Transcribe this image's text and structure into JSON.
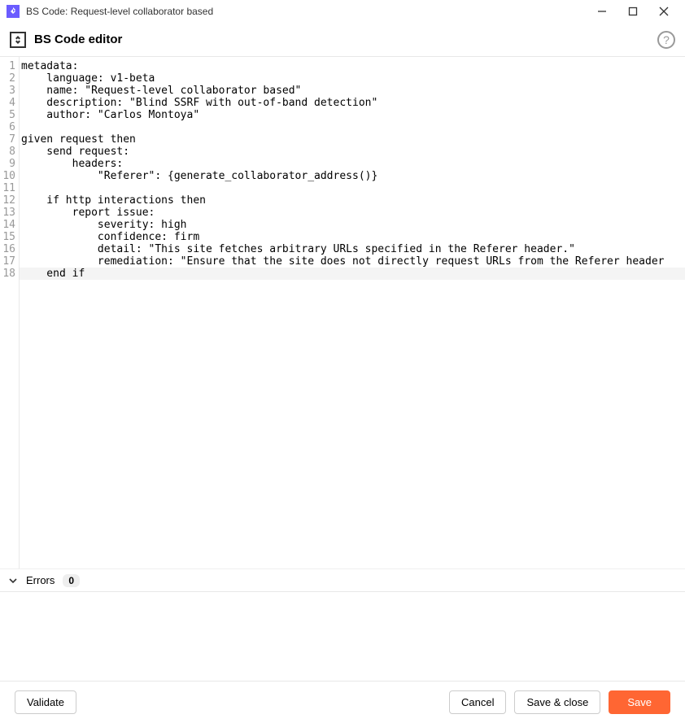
{
  "window": {
    "title": "BS Code: Request-level collaborator based"
  },
  "header": {
    "title": "BS Code editor"
  },
  "editor": {
    "lines": [
      "metadata:",
      "    language: v1-beta",
      "    name: \"Request-level collaborator based\"",
      "    description: \"Blind SSRF with out-of-band detection\"",
      "    author: \"Carlos Montoya\"",
      "",
      "given request then",
      "    send request:",
      "        headers:",
      "            \"Referer\": {generate_collaborator_address()}",
      "",
      "    if http interactions then",
      "        report issue:",
      "            severity: high",
      "            confidence: firm",
      "            detail: \"This site fetches arbitrary URLs specified in the Referer header.\"",
      "            remediation: \"Ensure that the site does not directly request URLs from the Referer header",
      "    end if"
    ],
    "highlight_line": 18
  },
  "errors": {
    "label": "Errors",
    "count": "0"
  },
  "footer": {
    "validate": "Validate",
    "cancel": "Cancel",
    "save_close": "Save & close",
    "save": "Save"
  }
}
